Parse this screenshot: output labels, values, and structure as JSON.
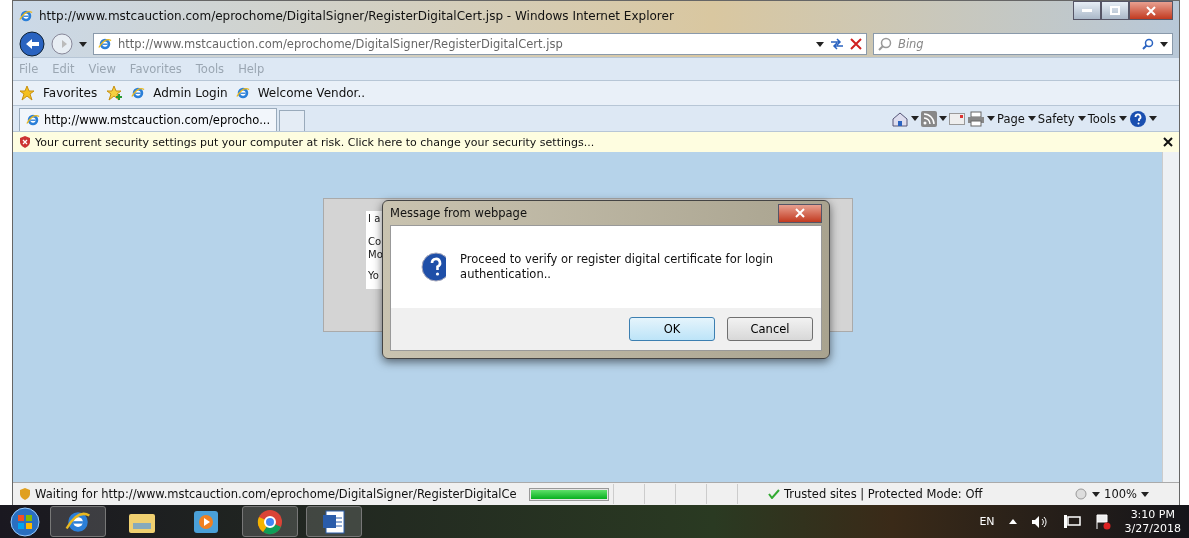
{
  "window": {
    "title": "http://www.mstcauction.com/eprochome/DigitalSigner/RegisterDigitalCert.jsp - Windows Internet Explorer"
  },
  "address_bar": {
    "value": "http://www.mstcauction.com/eprochome/DigitalSigner/RegisterDigitalCert.jsp"
  },
  "search": {
    "placeholder": "Bing"
  },
  "menu": [
    "File",
    "Edit",
    "View",
    "Favorites",
    "Tools",
    "Help"
  ],
  "favorites_bar": {
    "label": "Favorites",
    "links": [
      "Admin Login",
      "Welcome Vendor.."
    ]
  },
  "tabs": [
    {
      "label": "http://www.mstcauction.com/eprocho...",
      "selected": true
    }
  ],
  "command_bar": [
    "Page",
    "Safety",
    "Tools"
  ],
  "info_bar": {
    "text": "Your current security settings put your computer at risk. Click here to change your security settings..."
  },
  "page_fragments": [
    "I a",
    "Co",
    "Mo",
    "Yo"
  ],
  "dialog": {
    "title": "Message from webpage",
    "message": "Proceed to verify or register digital certificate for login authentication..",
    "buttons": [
      {
        "label": "OK",
        "selected": true
      },
      {
        "label": "Cancel",
        "selected": false
      }
    ]
  },
  "status_bar": {
    "text": "Waiting for http://www.mstcauction.com/eprochome/DigitalSigner/RegisterDigitalCe",
    "progress": {
      "level": 1
    },
    "zone": "Trusted sites | Protected Mode: Off",
    "zoom": "100%"
  },
  "taskbar": {
    "language": "EN",
    "time": "3:10 PM",
    "date": "3/27/2018"
  }
}
